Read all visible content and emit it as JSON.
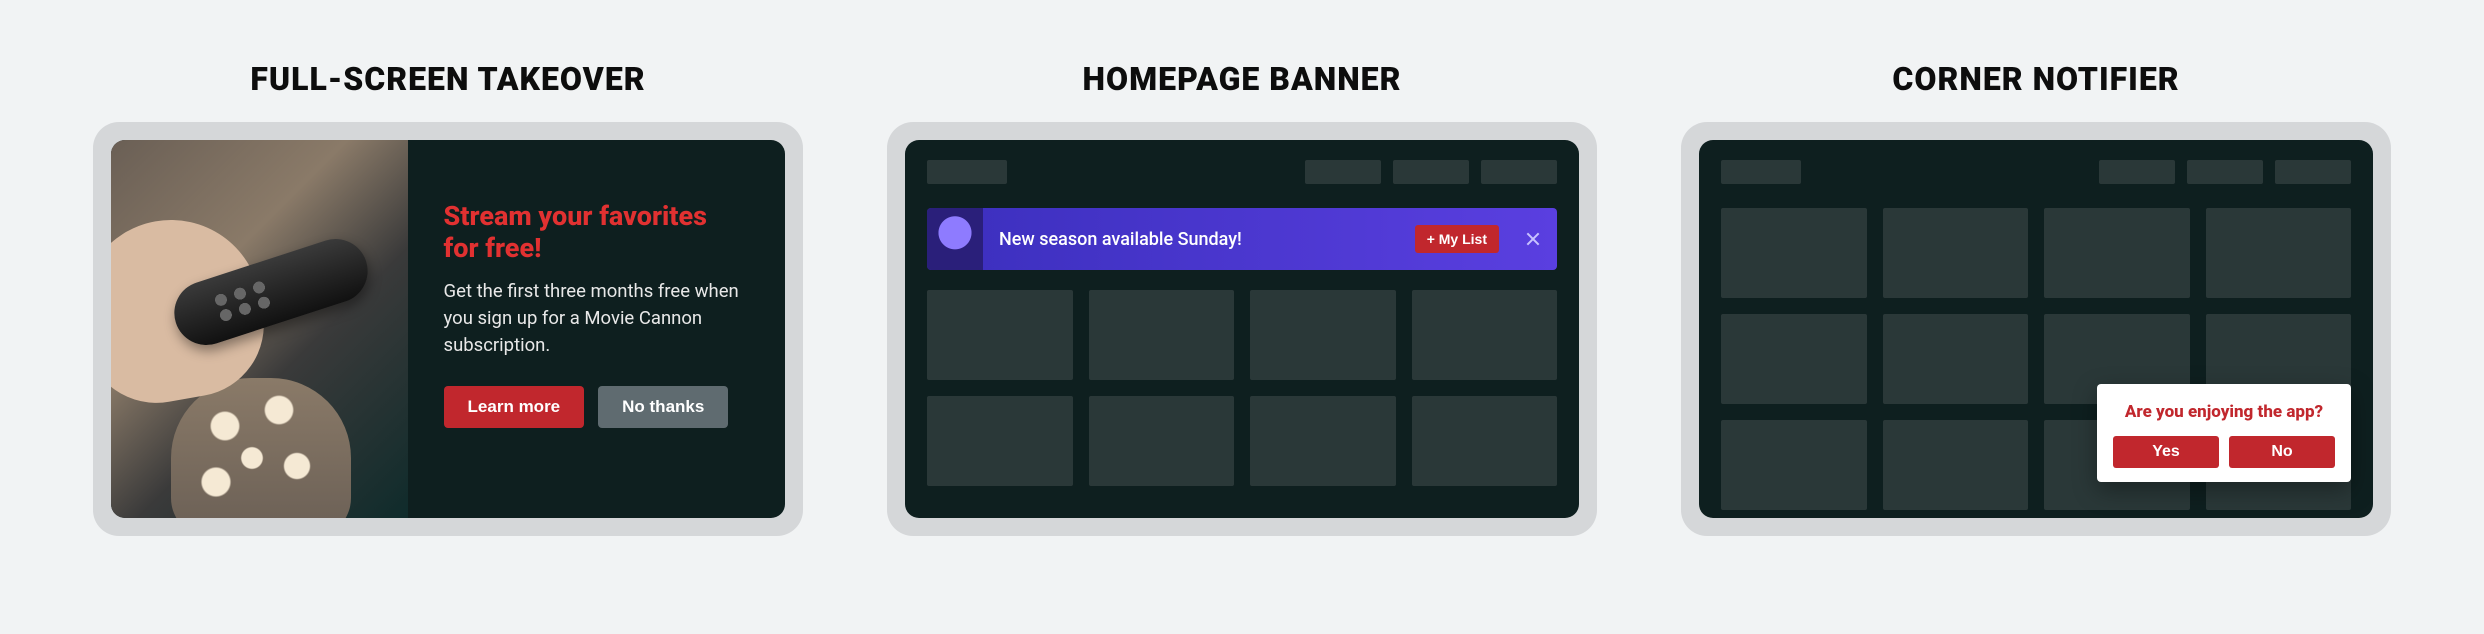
{
  "examples": [
    {
      "title": "FULL-SCREEN TAKEOVER"
    },
    {
      "title": "HOMEPAGE BANNER"
    },
    {
      "title": "CORNER NOTIFIER"
    }
  ],
  "takeover": {
    "headline": "Stream your favorites for free!",
    "body": "Get the first three months free when you sign up for a Movie Cannon subscription.",
    "primary_label": "Learn more",
    "secondary_label": "No thanks"
  },
  "homepage_banner": {
    "text": "New season available Sunday!",
    "cta_label": "+ My List"
  },
  "corner_notifier": {
    "title": "Are you enjoying the app?",
    "yes_label": "Yes",
    "no_label": "No"
  },
  "colors": {
    "accent_red": "#c1272d",
    "banner_purple": "#4a36d6",
    "screen_bg": "#0e1f1f",
    "frame_grey": "#d5d7d9"
  }
}
